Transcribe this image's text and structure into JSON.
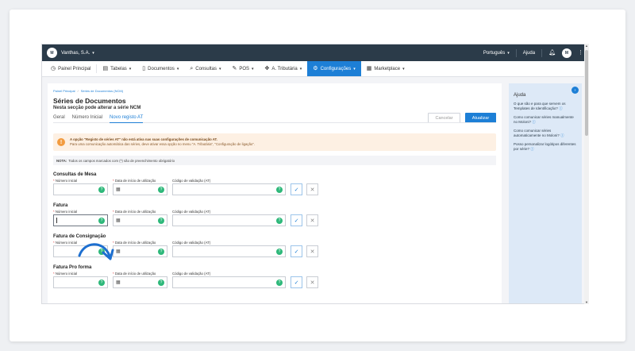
{
  "topbar": {
    "logo_text": "M",
    "company": "Vanthas, S.A.",
    "language": "Português",
    "help": "Ajuda",
    "avatar_text": "M"
  },
  "nav": {
    "items": [
      {
        "label": "Painel Principal",
        "icon": "dashboard-icon"
      },
      {
        "label": "Tabelas",
        "icon": "table-icon"
      },
      {
        "label": "Documentos",
        "icon": "document-icon"
      },
      {
        "label": "Consultas",
        "icon": "search-icon"
      },
      {
        "label": "POS",
        "icon": "pos-icon"
      },
      {
        "label": "A. Tributária",
        "icon": "tax-icon"
      },
      {
        "label": "Configurações",
        "icon": "settings-icon"
      },
      {
        "label": "Marketplace",
        "icon": "marketplace-icon"
      }
    ],
    "active": "Configurações"
  },
  "breadcrumb": [
    "Painel Principal",
    "Séries de Documentos (NCM)"
  ],
  "page": {
    "title": "Séries de Documentos",
    "subtitle": "Nesta secção pode alterar a série NCM"
  },
  "tabs": [
    "Geral",
    "Número Inicial",
    "Novo registo AT"
  ],
  "actions": {
    "cancel": "Cancelar",
    "save": "Atualizar"
  },
  "alert": {
    "line1": "A opção \"Registo de séries AT\" não está ativa nas suas configurações de comunicação AT.",
    "line2": "Para uma comunicação automática das séries, deve ativar essa opção no menu \"A. Tributária\", \"Configuração de ligação\"."
  },
  "note": {
    "label": "NOTA:",
    "text": "Todos os campos marcados com (*) são de preenchimento obrigatório"
  },
  "field_labels": {
    "number": "Número inicial",
    "date": "Data de início de utilização",
    "code": "Código de validação (AT)",
    "required_mark": "*"
  },
  "sections": [
    {
      "title": "Consultas de Mesa"
    },
    {
      "title": "Fatura"
    },
    {
      "title": "Fatura de Consignação"
    },
    {
      "title": "Fatura Pro forma"
    }
  ],
  "help": {
    "title": "Ajuda",
    "links": [
      "O que são e para que servem os Templates de Identificação?",
      "Como comunicar séries manualmente no Moloni?",
      "Como comunicar séries automaticamente no Moloni?",
      "Posso personalizar logótipos diferentes por série?"
    ]
  },
  "colors": {
    "accent": "#1d7fd6",
    "topbar": "#2b3b49",
    "alert_bg": "#fdf0e3",
    "alert_icon": "#f29b3f",
    "hint": "#2eb87a"
  }
}
